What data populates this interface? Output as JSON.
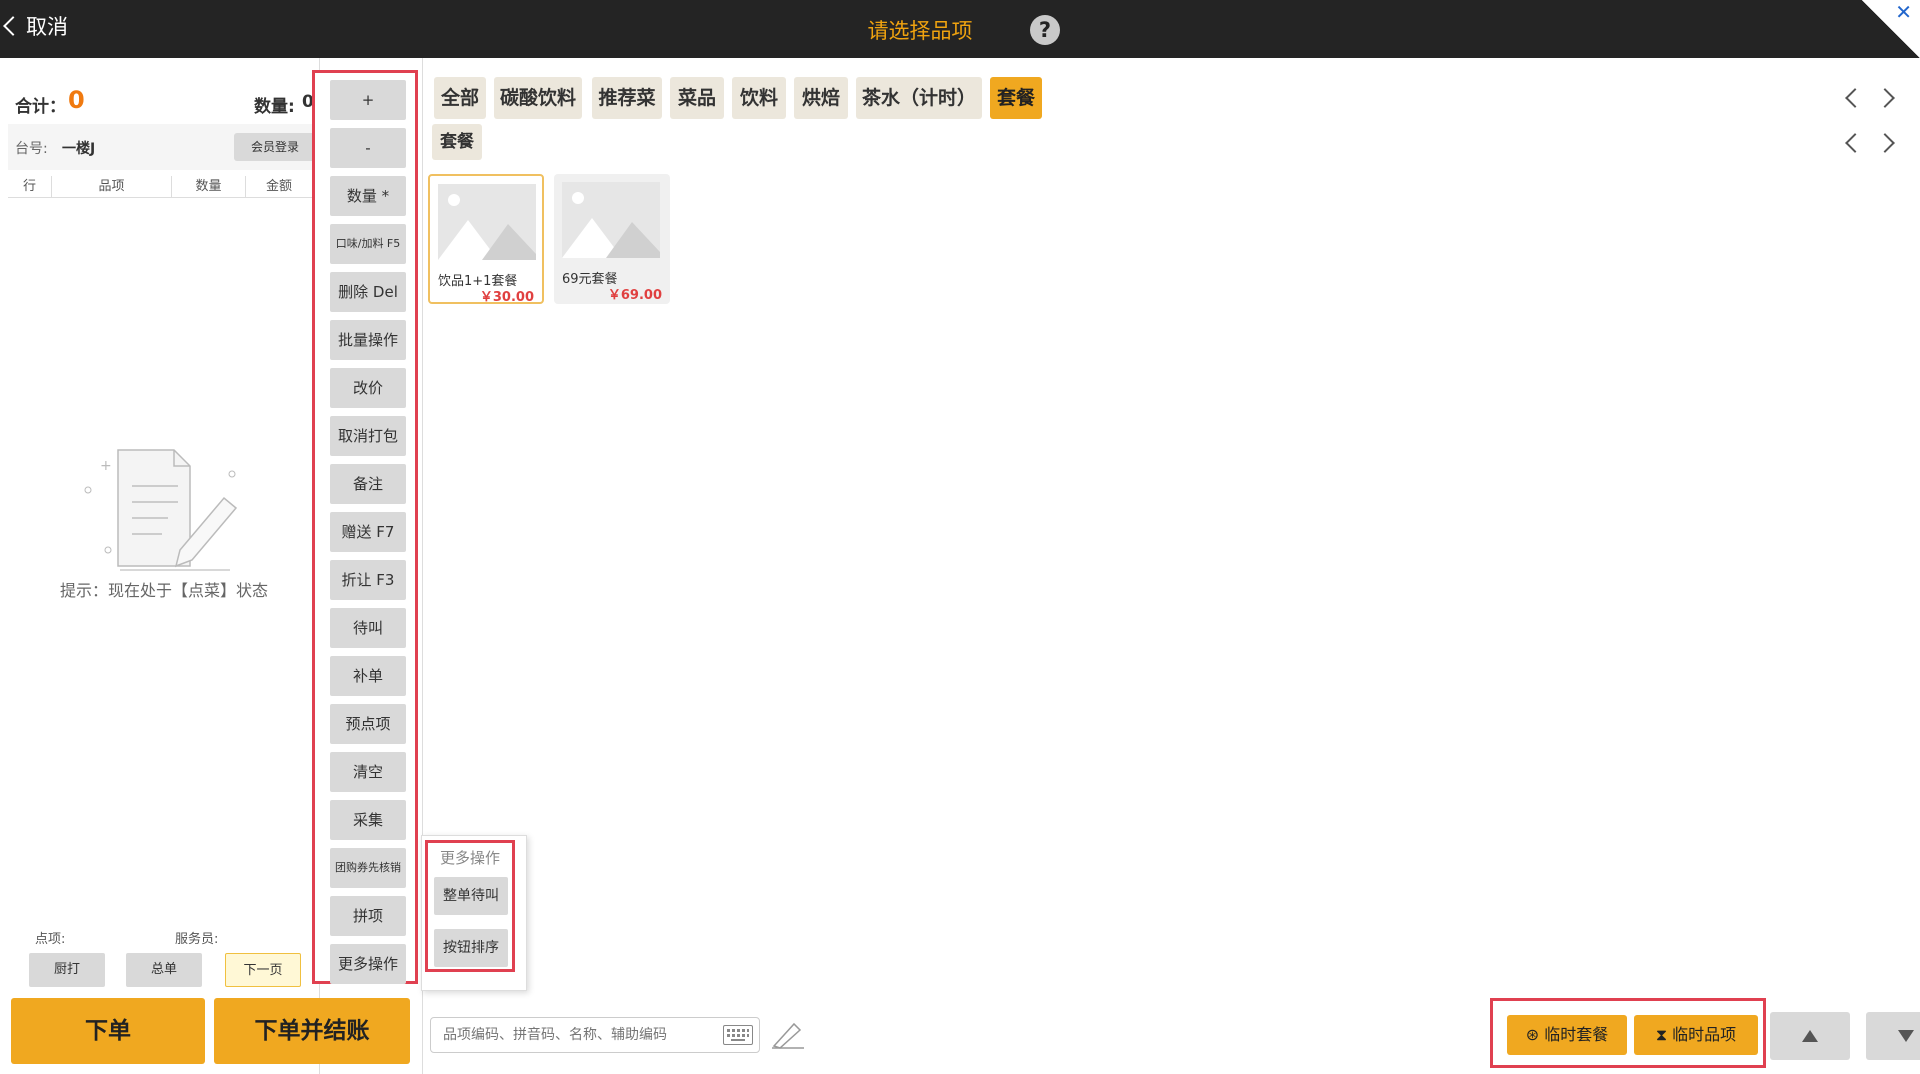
{
  "header": {
    "back_label": "取消",
    "title": "请选择品项",
    "help_label": "?",
    "close_label": "✕"
  },
  "order": {
    "total_label": "合计：",
    "total_value": "0",
    "qty_label": "数量:",
    "qty_value": "0",
    "table_label": "台号:",
    "table_value": "一楼J",
    "member_login": "会员登录",
    "columns": [
      "行",
      "品项",
      "数量",
      "金额"
    ],
    "hint": "提示：现在处于【点菜】状态"
  },
  "bottom_left": {
    "items_label": "点项:",
    "waiter_label": "服务员:",
    "kitchen_print": "厨打",
    "summary": "总单",
    "next_page": "下一页",
    "place_order": "下单",
    "place_and_checkout": "下单并结账"
  },
  "actions": [
    "+",
    "-",
    "数量 *",
    "口味/加料 F5",
    "删除 Del",
    "批量操作",
    "改价",
    "取消打包",
    "备注",
    "赠送 F7",
    "折让 F3",
    "待叫",
    "补单",
    "预点项",
    "清空",
    "采集",
    "团购券先核销",
    "拼项",
    "更多操作"
  ],
  "categories": [
    "全部",
    "碳酸饮料",
    "推荐菜",
    "菜品",
    "饮料",
    "烘焙",
    "茶水（计时）",
    "套餐"
  ],
  "active_category": "套餐",
  "subcategory": "套餐",
  "items": [
    {
      "name": "饮品1+1套餐",
      "price": "￥30.00"
    },
    {
      "name": "69元套餐",
      "price": "￥69.00"
    }
  ],
  "more_ops": {
    "title": "更多操作",
    "items": [
      "整单待叫",
      "按钮排序"
    ]
  },
  "search": {
    "placeholder": "品项编码、拼音码、名称、辅助编码"
  },
  "temp": {
    "temp_combo": "临时套餐",
    "temp_item": "临时品项"
  },
  "colors": {
    "accent": "#f0a820",
    "header_bg": "#242424",
    "highlight_border": "#e04050",
    "total_value": "#f07a10",
    "price": "#e04040"
  }
}
